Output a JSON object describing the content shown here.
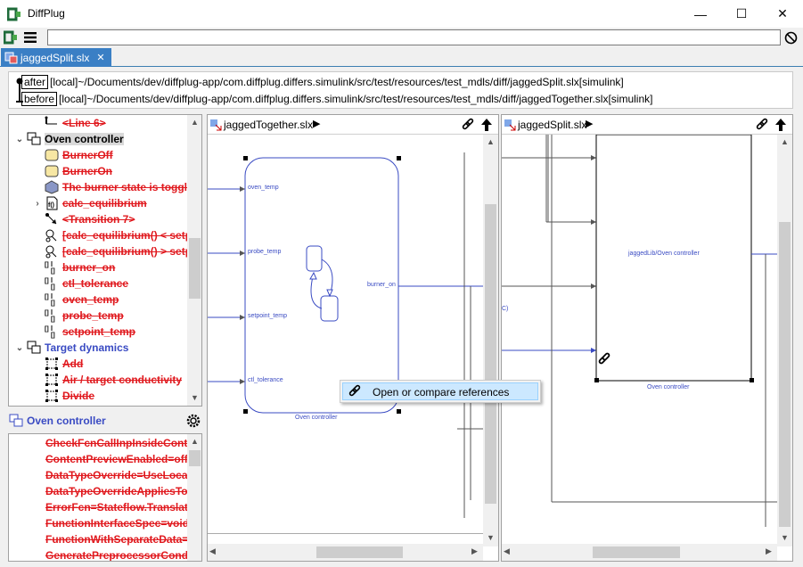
{
  "app": {
    "title": "DiffPlug"
  },
  "window": {
    "minimize": "—",
    "maximize": "☐",
    "close": "✕"
  },
  "toolbar": {
    "menu_icon": "hamburger-icon",
    "cancel_icon": "no-entry-icon"
  },
  "tab": {
    "label": "jaggedSplit.slx",
    "close": "✕"
  },
  "paths": {
    "after_tag": "after",
    "after_path": "[local]~/Documents/dev/diffplug-app/com.diffplug.differs.simulink/src/test/resources/test_mdls/diff/jaggedSplit.slx[simulink]",
    "before_tag": "before",
    "before_path": "[local]~/Documents/dev/diffplug-app/com.diffplug.differs.simulink/src/test/resources/test_mdls/diff/jaggedTogether.slx[simulink]"
  },
  "tree": [
    {
      "label": "<Line 6>",
      "style": "red",
      "indent": 1,
      "icon": "line-icon"
    },
    {
      "label": "Oven controller",
      "style": "bold",
      "indent": 0,
      "icon": "subsystem-icon",
      "expanded": true,
      "selected": true
    },
    {
      "label": "BurnerOff",
      "style": "red",
      "indent": 1,
      "icon": "state-icon"
    },
    {
      "label": "BurnerOn",
      "style": "red",
      "indent": 1,
      "icon": "state-icon"
    },
    {
      "label": "The burner state is toggled",
      "style": "red",
      "indent": 1,
      "icon": "annotation-icon"
    },
    {
      "label": "calc_equilibrium",
      "style": "red",
      "indent": 1,
      "icon": "function-icon",
      "collapsed": true
    },
    {
      "label": "<Transition 7>",
      "style": "red",
      "indent": 1,
      "icon": "transition-icon"
    },
    {
      "label": "[calc_equilibrium() < setpoint]",
      "style": "red",
      "indent": 1,
      "icon": "condition-icon"
    },
    {
      "label": "[calc_equilibrium() > setpoint]",
      "style": "red",
      "indent": 1,
      "icon": "condition-icon"
    },
    {
      "label": "burner_on",
      "style": "red",
      "indent": 1,
      "icon": "data-icon"
    },
    {
      "label": "ctl_tolerance",
      "style": "red",
      "indent": 1,
      "icon": "data-icon"
    },
    {
      "label": "oven_temp",
      "style": "red",
      "indent": 1,
      "icon": "data-icon"
    },
    {
      "label": "probe_temp",
      "style": "red",
      "indent": 1,
      "icon": "data-icon"
    },
    {
      "label": "setpoint_temp",
      "style": "red",
      "indent": 1,
      "icon": "data-icon"
    },
    {
      "label": "Target dynamics",
      "style": "blue",
      "indent": 0,
      "icon": "subsystem-icon",
      "expanded": true
    },
    {
      "label": "Add",
      "style": "red",
      "indent": 1,
      "icon": "block-icon"
    },
    {
      "label": "Air / target conductivity",
      "style": "red",
      "indent": 1,
      "icon": "block-icon"
    },
    {
      "label": "Divide",
      "style": "red",
      "indent": 1,
      "icon": "block-icon"
    }
  ],
  "props_header": {
    "label": "Oven controller",
    "gear": "gear-icon"
  },
  "props": [
    "CheckFcnCallInpInsideContextMsg",
    "ContentPreviewEnabled=off",
    "DataTypeOverride=UseLocalSettings",
    "DataTypeOverrideAppliesTo=AllNumericTypes",
    "ErrorFcn=Stateflow.Translate",
    "FunctionInterfaceSpec=void_void",
    "FunctionWithSeparateData=off",
    "GeneratePreprocessorConditionals"
  ],
  "left_pane": {
    "title": "jaggedTogether.slx",
    "block_label": "Oven controller",
    "ports": [
      "oven_temp",
      "probe_temp",
      "setpoint_temp",
      "ctl_tolerance"
    ],
    "out_port": "burner_on"
  },
  "right_pane": {
    "title": "jaggedSplit.slx",
    "block_label": "Oven controller",
    "lib_label": "jaggedLib/Oven controller",
    "cut_label": "C)"
  },
  "context_menu": {
    "item": "Open or compare references"
  }
}
